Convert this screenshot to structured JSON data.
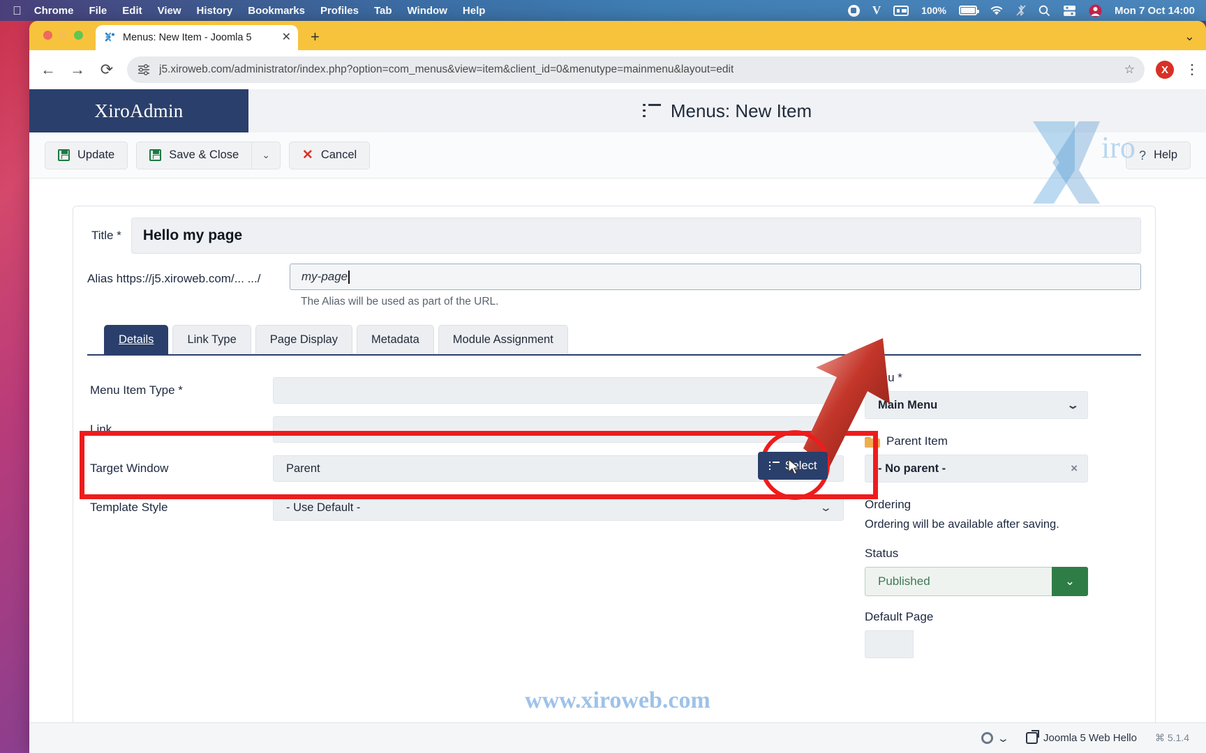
{
  "menubar": {
    "apple": "apple-logo",
    "items": [
      "Chrome",
      "File",
      "Edit",
      "View",
      "History",
      "Bookmarks",
      "Profiles",
      "Tab",
      "Window",
      "Help"
    ],
    "battery_percent": "100%",
    "clock": "Mon 7 Oct  14:00"
  },
  "browser": {
    "tab_title": "Menus: New Item - Joomla 5",
    "tab_close": "✕",
    "newtab": "+",
    "window_chevron": "⌄",
    "back": "←",
    "forward": "→",
    "reload": "⟳",
    "url": "j5.xiroweb.com/administrator/index.php?option=com_menus&view=item&client_id=0&menutype=mainmenu&layout=edit",
    "star": "☆",
    "profile_initial": "X",
    "kebab": "⋮"
  },
  "admin": {
    "brand": "XiroAdmin",
    "page_title": "Menus: New Item",
    "toolbar": {
      "update": "Update",
      "save_close": "Save & Close",
      "save_chevron": "⌄",
      "cancel": "Cancel",
      "help": "Help",
      "help_icon": "?"
    }
  },
  "form": {
    "title_label": "Title *",
    "title_value": "Hello my page",
    "alias_label": "Alias https://j5.xiroweb.com/... .../",
    "alias_value": "my-page",
    "alias_hint": "The Alias will be used as part of the URL.",
    "tabs": [
      {
        "label": "Details",
        "active": true
      },
      {
        "label": "Link Type",
        "active": false
      },
      {
        "label": "Page Display",
        "active": false
      },
      {
        "label": "Metadata",
        "active": false
      },
      {
        "label": "Module Assignment",
        "active": false
      }
    ],
    "fields": [
      {
        "label": "Menu Item Type *",
        "value": "",
        "type": "text"
      },
      {
        "label": "Link",
        "value": "",
        "type": "text"
      },
      {
        "label": "Target Window",
        "value": "Parent",
        "type": "select"
      },
      {
        "label": "Template Style",
        "value": "- Use Default -",
        "type": "select"
      }
    ],
    "select_button": "Select"
  },
  "sidebar": {
    "menu_label": "Menu *",
    "menu_value": "Main Menu",
    "parent_label": "Parent Item",
    "parent_value": "- No parent -",
    "parent_clear": "×",
    "ordering_label": "Ordering",
    "ordering_text": "Ordering will be available after saving.",
    "status_label": "Status",
    "status_value": "Published",
    "default_page_label": "Default Page",
    "chevron": "⌄"
  },
  "watermark": {
    "url": "www.xiroweb.com",
    "logo": "Xiro"
  },
  "footer": {
    "gear": "gear-icon",
    "site_name": "Joomla 5 Web Hello",
    "version": "⌘ 5.1.4"
  },
  "colors": {
    "brand_navy": "#2a3f6b",
    "annotation_red": "#ee1c1c",
    "status_green": "#2f7d46",
    "tab_yellow": "#f8c33c"
  }
}
